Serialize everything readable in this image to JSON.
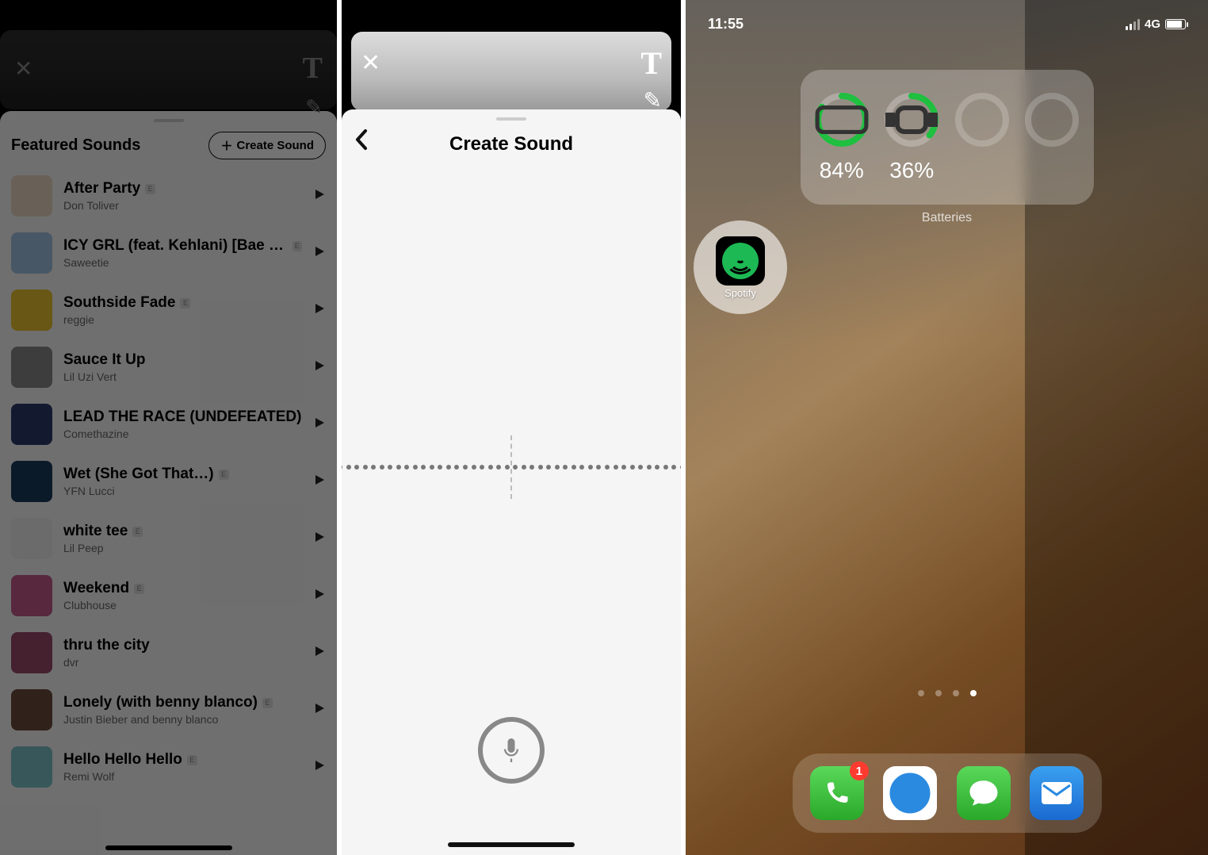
{
  "left": {
    "sheet_title": "Featured Sounds",
    "create_button": "Create Sound",
    "sounds": [
      {
        "title": "After Party",
        "artist": "Don Toliver",
        "explicit": true
      },
      {
        "title": "ICY GRL (feat. Kehlani) [Bae Mix]",
        "artist": "Saweetie",
        "explicit": true
      },
      {
        "title": "Southside Fade",
        "artist": "reggie",
        "explicit": true
      },
      {
        "title": "Sauce It Up",
        "artist": "Lil Uzi Vert",
        "explicit": false
      },
      {
        "title": "LEAD THE RACE (UNDEFEATED)",
        "artist": "Comethazine",
        "explicit": false
      },
      {
        "title": "Wet (She Got That…)",
        "artist": "YFN Lucci",
        "explicit": true
      },
      {
        "title": "white tee",
        "artist": "Lil Peep",
        "explicit": true
      },
      {
        "title": "Weekend",
        "artist": "Clubhouse",
        "explicit": true
      },
      {
        "title": "thru the city",
        "artist": "dvr",
        "explicit": false
      },
      {
        "title": "Lonely (with benny blanco)",
        "artist": "Justin Bieber and benny blanco",
        "explicit": true
      },
      {
        "title": "Hello Hello Hello",
        "artist": "Remi Wolf",
        "explicit": true
      }
    ]
  },
  "mid": {
    "title": "Create Sound"
  },
  "right": {
    "status": {
      "time": "11:55",
      "network": "4G"
    },
    "batteries": {
      "label": "Batteries",
      "items": [
        {
          "device": "phone",
          "pct": "84%",
          "ring_pct": 84
        },
        {
          "device": "watch",
          "pct": "36%",
          "ring_pct": 36
        }
      ]
    },
    "spotify_label": "Spotify",
    "dock": {
      "phone_badge": "1"
    },
    "page_dots": {
      "count": 4,
      "active": 3
    }
  }
}
